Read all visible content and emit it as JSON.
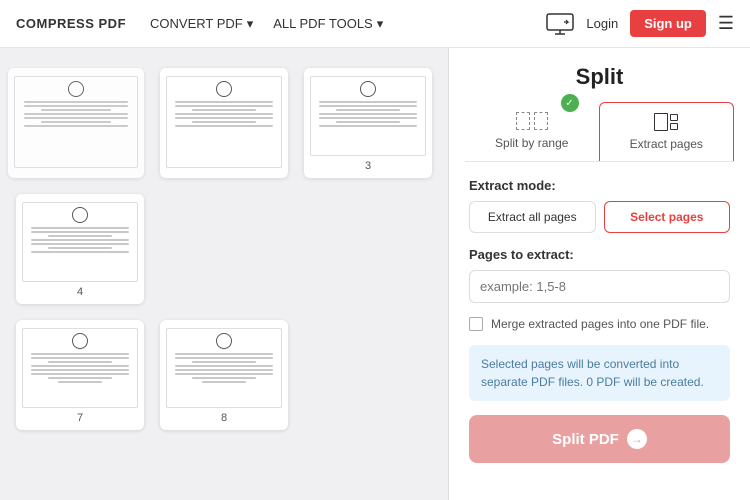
{
  "header": {
    "brand": "COMPRESS PDF",
    "nav": [
      {
        "label": "CONVERT PDF",
        "has_arrow": true
      },
      {
        "label": "ALL PDF TOOLS",
        "has_arrow": true
      }
    ],
    "login_label": "Login",
    "signup_label": "Sign up"
  },
  "pdf_panel": {
    "thumbnails": [
      {
        "num": ""
      },
      {
        "num": ""
      },
      {
        "num": "3"
      },
      {
        "num": "4"
      },
      {
        "num": ""
      },
      {
        "num": ""
      },
      {
        "num": "7"
      },
      {
        "num": "8"
      }
    ]
  },
  "right_panel": {
    "title": "Split",
    "mode_tabs": [
      {
        "id": "split-range",
        "label": "Split by range",
        "active": false
      },
      {
        "id": "extract-pages",
        "label": "Extract pages",
        "active": true
      }
    ],
    "extract_mode_label": "Extract mode:",
    "extract_mode_options": [
      {
        "label": "Extract all pages",
        "active": false
      },
      {
        "label": "Select pages",
        "active": true
      }
    ],
    "pages_label": "Pages to extract:",
    "pages_placeholder": "example: 1,5-8",
    "merge_label": "Merge extracted pages into one PDF file.",
    "info_text": "Selected pages will be converted into separate PDF files. 0 PDF will be created.",
    "split_btn_label": "Split PDF",
    "split_btn_icon": "→"
  }
}
